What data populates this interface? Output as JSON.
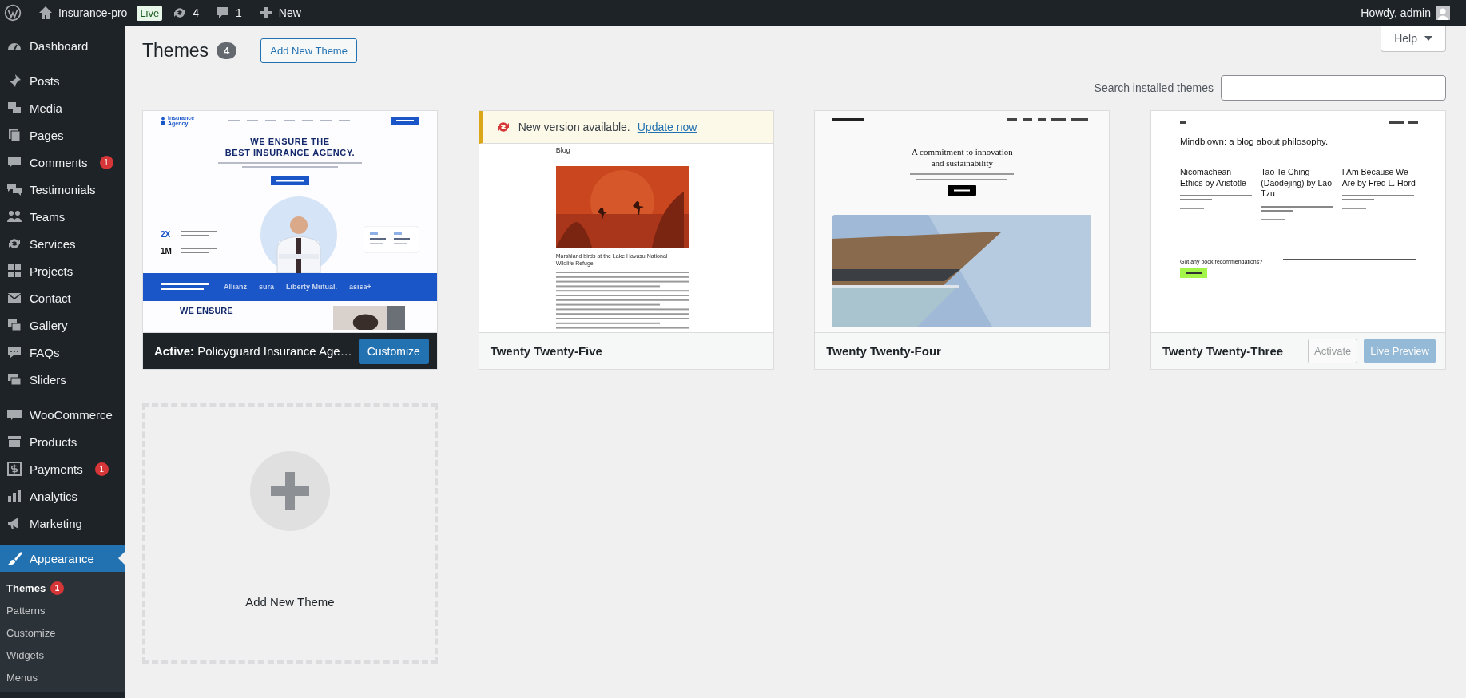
{
  "admin_bar": {
    "site": "Insurance-pro",
    "badge": "Live",
    "updates": "4",
    "comments": "1",
    "new": "New",
    "greeting": "Howdy, admin"
  },
  "sidebar": {
    "groups": [
      {
        "items": [
          {
            "label": "Dashboard",
            "selected": false
          }
        ]
      },
      {
        "items": [
          {
            "label": "Posts",
            "selected": false
          },
          {
            "label": "Media",
            "selected": false
          },
          {
            "label": "Pages",
            "selected": false
          },
          {
            "label": "Comments",
            "badge": "1",
            "selected": false
          },
          {
            "label": "Testimonials",
            "selected": false
          },
          {
            "label": "Teams",
            "selected": false
          },
          {
            "label": "Services",
            "selected": false
          },
          {
            "label": "Projects",
            "selected": false
          },
          {
            "label": "Contact",
            "selected": false
          },
          {
            "label": "Gallery",
            "selected": false
          },
          {
            "label": "FAQs",
            "selected": false
          },
          {
            "label": "Sliders",
            "selected": false
          }
        ]
      },
      {
        "items": [
          {
            "label": "WooCommerce",
            "selected": false
          },
          {
            "label": "Products",
            "selected": false
          },
          {
            "label": "Payments",
            "badge": "1",
            "selected": false
          },
          {
            "label": "Analytics",
            "selected": false
          },
          {
            "label": "Marketing",
            "selected": false
          }
        ]
      },
      {
        "items": [
          {
            "label": "Appearance",
            "selected": true,
            "children": [
              {
                "label": "Themes",
                "badge": "1",
                "selected": true
              },
              {
                "label": "Patterns",
                "selected": false
              },
              {
                "label": "Customize",
                "selected": false
              },
              {
                "label": "Widgets",
                "selected": false
              },
              {
                "label": "Menus",
                "selected": false
              }
            ]
          }
        ]
      }
    ]
  },
  "page": {
    "title": "Themes",
    "count": "4",
    "add_button": "Add New Theme",
    "help": "Help",
    "search": {
      "label": "Search installed themes"
    }
  },
  "themes": [
    {
      "name": "Policyguard Insurance Age…",
      "active": true,
      "active_label": "Active:",
      "action": "Customize",
      "preview": {
        "kind": "insurance",
        "logo": [
          "Insurance",
          "Agency"
        ],
        "headline": [
          "WE ENSURE THE",
          "BEST INSURANCE AGENCY."
        ],
        "stats": [
          "2X",
          "1M"
        ],
        "brands": [
          "Allianz",
          "sura",
          "Liberty Mutual.",
          "asisa+"
        ],
        "headline2": "WE ENSURE"
      }
    },
    {
      "name": "Twenty Twenty-Five",
      "active": false,
      "notice": {
        "text": "New version available.",
        "link": "Update now"
      },
      "preview": {
        "kind": "blog",
        "heading": "Blog",
        "post_title": "Marshland birds at the Lake Havasu National Wildlife Refuge"
      }
    },
    {
      "name": "Twenty Twenty-Four",
      "active": false,
      "preview": {
        "kind": "architecture",
        "headline": [
          "A commitment to innovation",
          "and sustainability"
        ]
      }
    },
    {
      "name": "Twenty Twenty-Three",
      "active": false,
      "actions": [
        "Activate",
        "Live Preview"
      ],
      "preview": {
        "kind": "philosophy",
        "headline": "Mindblown: a blog about philosophy.",
        "posts": [
          "Nicomachean Ethics by Aristotle",
          "Tao Te Ching (Daodejing) by Lao Tzu",
          "I Am Because We Are by Fred L. Hord"
        ],
        "cta": "Got any book recommendations?"
      }
    }
  ],
  "add_new": {
    "label": "Add New Theme"
  }
}
